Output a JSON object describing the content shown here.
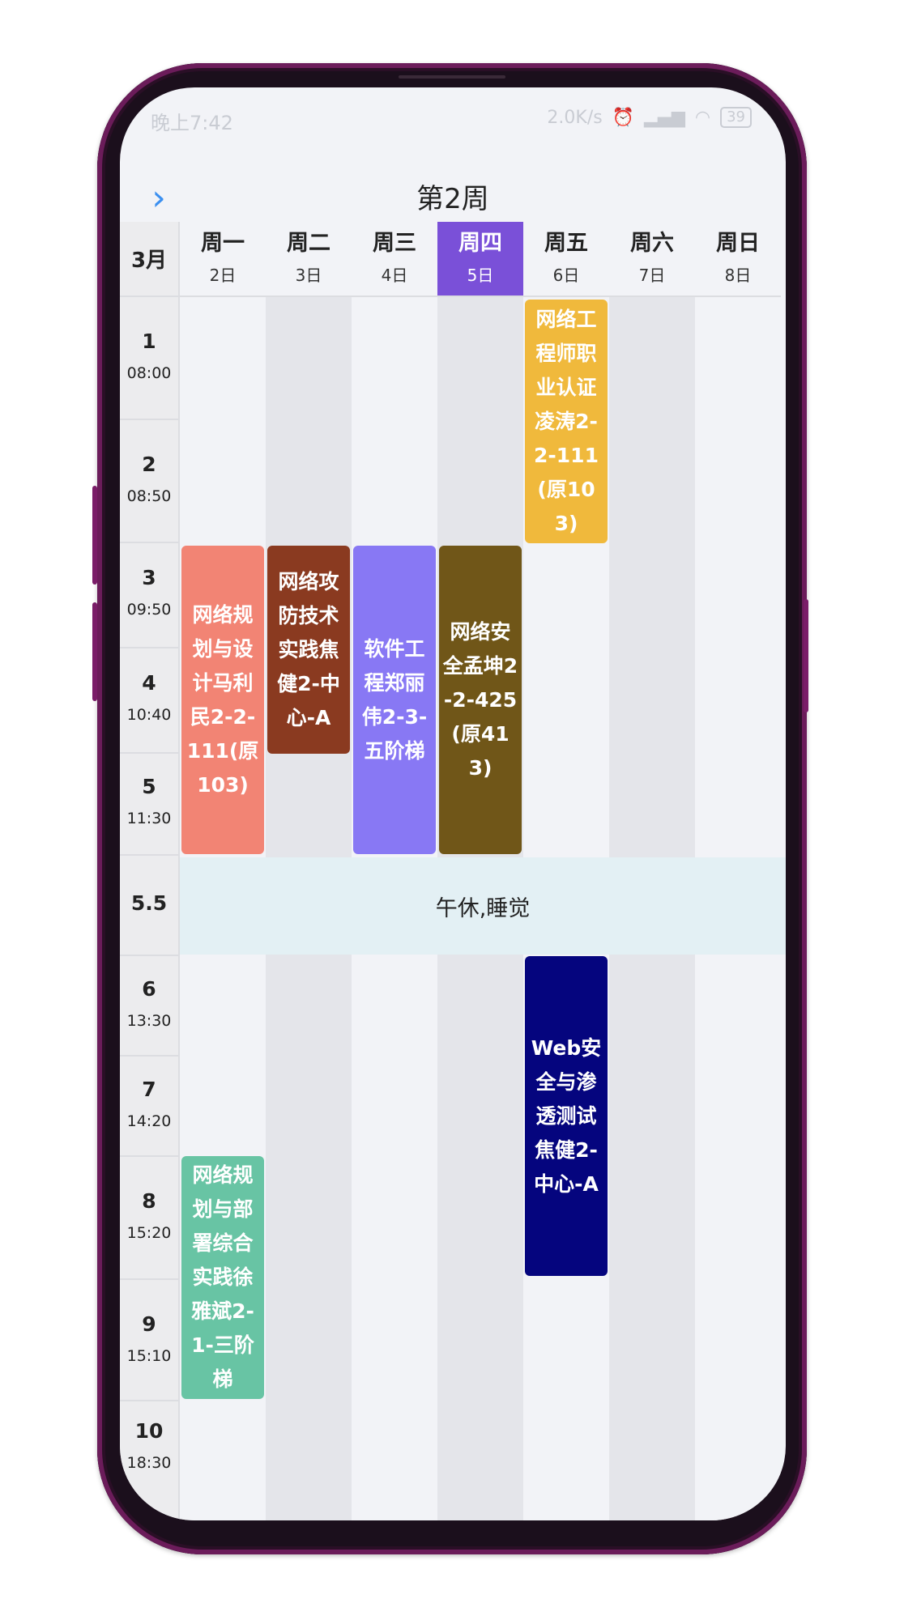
{
  "status": {
    "time": "晚上7:42",
    "speed": "2.0K/s",
    "battery": "39"
  },
  "header": {
    "title": "第2周",
    "back_icon": "chevron-right-icon"
  },
  "month": "3月",
  "days": [
    {
      "name": "周一",
      "date": "2日"
    },
    {
      "name": "周二",
      "date": "3日"
    },
    {
      "name": "周三",
      "date": "4日"
    },
    {
      "name": "周四",
      "date": "5日"
    },
    {
      "name": "周五",
      "date": "6日"
    },
    {
      "name": "周六",
      "date": "7日"
    },
    {
      "name": "周日",
      "date": "8日"
    }
  ],
  "slots": [
    {
      "num": "1",
      "time": "08:00"
    },
    {
      "num": "2",
      "time": "08:50"
    },
    {
      "num": "3",
      "time": "09:50"
    },
    {
      "num": "4",
      "time": "10:40"
    },
    {
      "num": "5",
      "time": "11:30"
    },
    {
      "num": "5.5",
      "time": ""
    },
    {
      "num": "6",
      "time": "13:30"
    },
    {
      "num": "7",
      "time": "14:20"
    },
    {
      "num": "8",
      "time": "15:20"
    },
    {
      "num": "9",
      "time": "15:10"
    },
    {
      "num": "10",
      "time": "18:30"
    }
  ],
  "lunch": "午休,睡觉",
  "courses": [
    {
      "text": "网络工程师职业认证凌涛2-2-111(原103)",
      "color": "#f0b93c"
    },
    {
      "text": "网络规划与设计马利民2-2-111(原103)",
      "color": "#f28474"
    },
    {
      "text": "网络攻防技术实践焦健2-中心-A",
      "color": "#8a3a20"
    },
    {
      "text": "软件工程郑丽伟2-3-五阶梯",
      "color": "#8878f4"
    },
    {
      "text": "网络安全孟坤2-2-425(原413)",
      "color": "#705618"
    },
    {
      "text": "Web安全与渗透测试焦健2-中心-A",
      "color": "#05057e"
    },
    {
      "text": "网络规划与部署综合实践徐雅斌2-1-三阶梯",
      "color": "#68c4a4"
    }
  ]
}
